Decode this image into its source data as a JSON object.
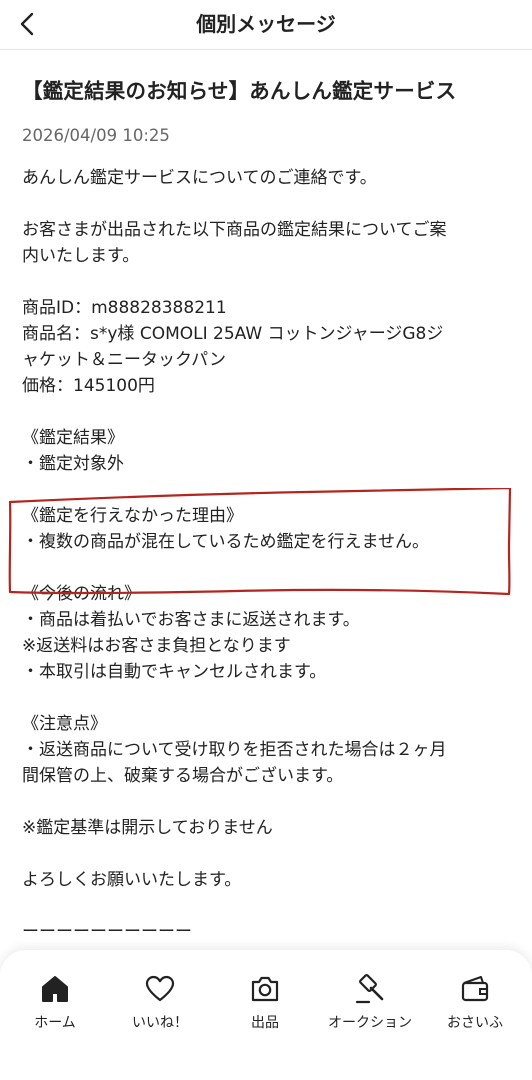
{
  "header": {
    "title": "個別メッセージ",
    "back_icon": "chevron-left-icon"
  },
  "message": {
    "title": "【鑑定結果のお知らせ】あんしん鑑定サービス",
    "date": "2026/04/09 10:25",
    "lines": [
      "あんしん鑑定サービスについてのご連絡です。",
      "",
      "お客さまが出品された以下商品の鑑定結果についてご案",
      "内いたします。",
      "",
      "商品ID：m88828388211",
      "商品名：s*y様 COMOLI 25AW コットンジャージG8ジ",
      "ャケット＆ニータックパン",
      "価格：145100円",
      "",
      "《鑑定結果》",
      "・鑑定対象外",
      "",
      "《鑑定を行えなかった理由》",
      "・複数の商品が混在しているため鑑定を行えません。",
      "",
      "《今後の流れ》",
      "・商品は着払いでお客さまに返送されます。",
      "※返送料はお客さま負担となります",
      "・本取引は自動でキャンセルされます。",
      "",
      "《注意点》",
      "・返送商品について受け取りを拒否された場合は２ヶ月",
      "間保管の上、破棄する場合がございます。",
      "",
      "※鑑定基準は開示しておりません",
      "",
      "よろしくお願いいたします。",
      "",
      "ーーーーーーーーーー"
    ]
  },
  "annotation": {
    "color": "#b3261e"
  },
  "tabbar": {
    "items": [
      {
        "label": "ホーム",
        "icon": "home-icon"
      },
      {
        "label": "いいね！",
        "icon": "heart-icon"
      },
      {
        "label": "出品",
        "icon": "camera-icon"
      },
      {
        "label": "オークション",
        "icon": "gavel-icon"
      },
      {
        "label": "おさいふ",
        "icon": "wallet-icon"
      }
    ]
  }
}
